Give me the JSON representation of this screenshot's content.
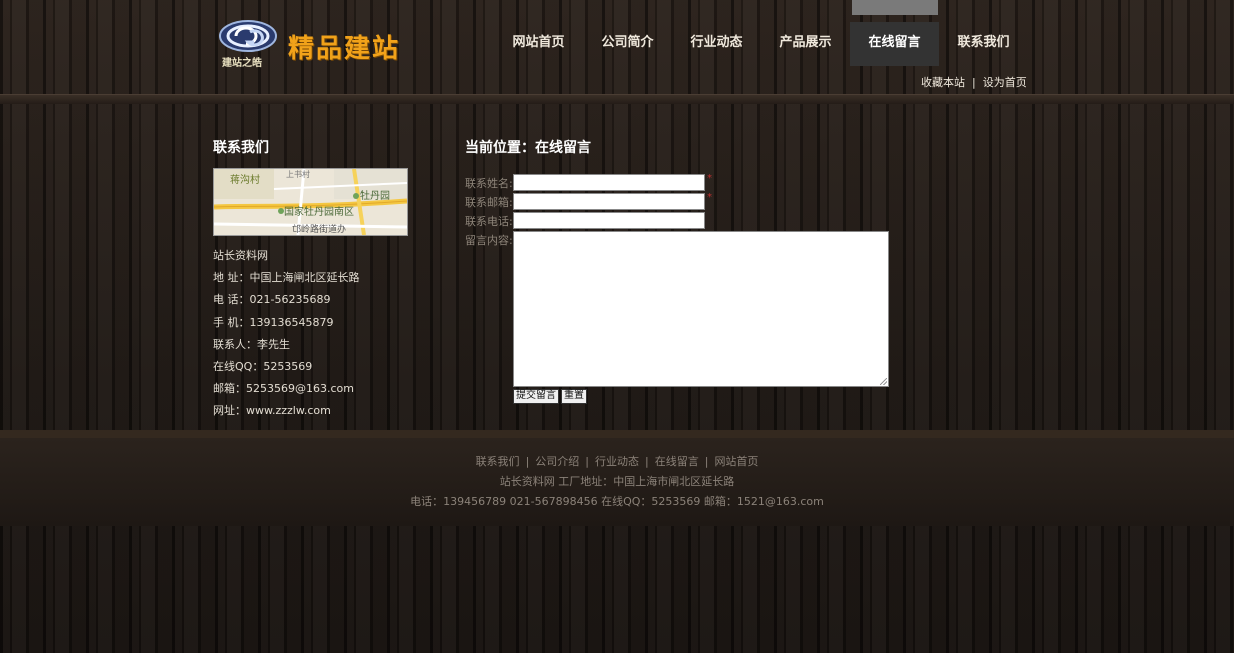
{
  "logo": {
    "badge_sub": "建站之皓",
    "brand_text": "精品建站"
  },
  "nav": [
    {
      "label": "网站首页"
    },
    {
      "label": "公司简介"
    },
    {
      "label": "行业动态"
    },
    {
      "label": "产品展示"
    },
    {
      "label": "在线留言",
      "active": true
    },
    {
      "label": "联系我们"
    }
  ],
  "toplinks": {
    "bookmark": "收藏本站",
    "sep": "|",
    "homepage": "设为首页"
  },
  "sidebar": {
    "title": "联系我们",
    "map_labels": {
      "village": "蒋沟村",
      "park": "牡丹园",
      "district": "国家牡丹园南区",
      "road": "邙岭路街道办",
      "top": "上书村"
    },
    "info": [
      "站长资料网",
      "地 址：中国上海闸北区延长路",
      "电 话：021-56235689",
      "手 机：139136545879",
      "联系人：李先生",
      "在线QQ：5253569",
      "邮箱：5253569@163.com",
      "网址：www.zzzlw.com"
    ]
  },
  "main": {
    "title": "当前位置：在线留言",
    "form": {
      "name_label": "联系姓名:",
      "email_label": "联系邮箱:",
      "phone_label": "联系电话:",
      "message_label": "留言内容:",
      "required_mark": "*",
      "submit_label": "提交留言",
      "reset_label": "重置"
    }
  },
  "footer": {
    "links": [
      "联系我们",
      "公司介绍",
      "行业动态",
      "在线留言",
      "网站首页"
    ],
    "sep": "|",
    "line2": "站长资料网 工厂地址：中国上海市闸北区延长路",
    "line3": "电话：139456789 021-567898456 在线QQ：5253569 邮箱：1521@163.com"
  },
  "colors": {
    "brand": "#f1a21a",
    "nav_active_bg": "#333333",
    "required": "#c03030"
  }
}
